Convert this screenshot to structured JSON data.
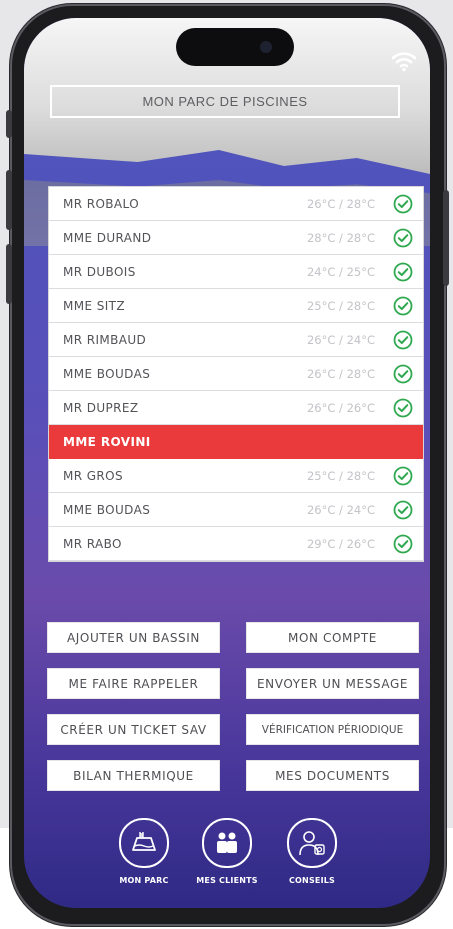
{
  "header": {
    "title": "MON PARC DE PISCINES"
  },
  "status_bar": {
    "icon": "wifi-icon"
  },
  "pools": [
    {
      "name": "MR ROBALO",
      "temp": "26°C / 28°C",
      "status": "ok"
    },
    {
      "name": "MME DURAND",
      "temp": "28°C / 28°C",
      "status": "ok"
    },
    {
      "name": "MR DUBOIS",
      "temp": "24°C / 25°C",
      "status": "ok"
    },
    {
      "name": "MME SITZ",
      "temp": "25°C / 28°C",
      "status": "ok"
    },
    {
      "name": "MR RIMBAUD",
      "temp": "26°C / 24°C",
      "status": "ok"
    },
    {
      "name": "MME BOUDAS",
      "temp": "26°C / 28°C",
      "status": "ok"
    },
    {
      "name": "MR DUPREZ",
      "temp": "26°C / 26°C",
      "status": "ok"
    },
    {
      "name": "MME ROVINI",
      "temp": "",
      "status": "alert"
    },
    {
      "name": "MR GROS",
      "temp": "25°C / 28°C",
      "status": "ok"
    },
    {
      "name": "MME BOUDAS",
      "temp": "26°C / 24°C",
      "status": "ok"
    },
    {
      "name": "MR RABO",
      "temp": "29°C / 26°C",
      "status": "ok"
    }
  ],
  "actions": {
    "add_pool": "AJOUTER UN BASSIN",
    "my_account": "MON COMPTE",
    "call_back": "ME FAIRE RAPPELER",
    "send_message": "ENVOYER UN MESSAGE",
    "create_ticket": "CRÉER UN TICKET SAV",
    "periodic_check": "VÉRIFICATION PÉRIODIQUE",
    "thermal_report": "BILAN THERMIQUE",
    "my_documents": "MES DOCUMENTS"
  },
  "nav": {
    "park": "MON PARC",
    "clients": "MES CLIENTS",
    "advice": "CONSEILS"
  },
  "colors": {
    "alert": "#ea3a3b",
    "check": "#2fa84f",
    "gradient_top": "#4a56bd",
    "gradient_bottom": "#2f2a85"
  }
}
